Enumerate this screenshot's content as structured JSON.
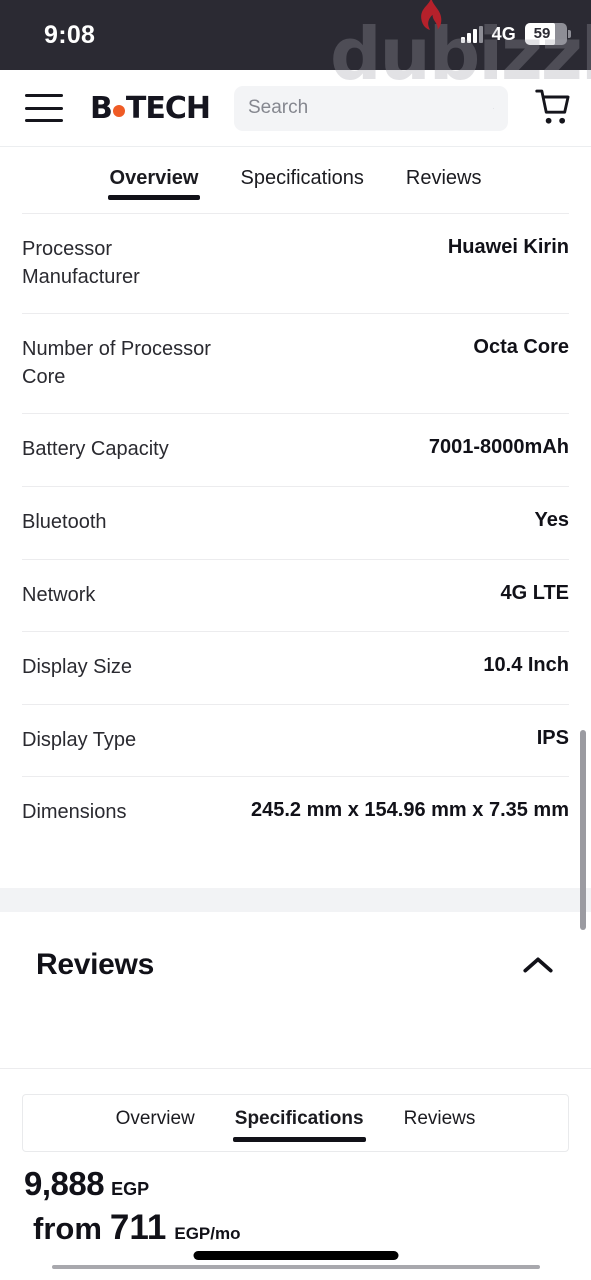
{
  "status_bar": {
    "time": "9:08",
    "network_label": "4G",
    "battery_level": "59",
    "signal_icon": "signal-bars-icon",
    "flame_icon": "flame-icon"
  },
  "watermark": {
    "text": "dubizzle"
  },
  "header": {
    "menu_icon": "hamburger-menu-icon",
    "logo": {
      "prefix": "B",
      "suffix": "TECH",
      "dot_color": "#ef5b25"
    },
    "search": {
      "value": "",
      "placeholder": "Search",
      "icon": "search-icon"
    },
    "cart_icon": "shopping-cart-icon"
  },
  "top_tabs": {
    "items": [
      {
        "label": "Overview",
        "active": true
      },
      {
        "label": "Specifications",
        "active": false
      },
      {
        "label": "Reviews",
        "active": false
      }
    ]
  },
  "specifications": {
    "rows": [
      {
        "label": "Processor Manufacturer",
        "value": "Huawei Kirin"
      },
      {
        "label": "Number of Processor Core",
        "value": "Octa Core"
      },
      {
        "label": "Battery Capacity",
        "value": "7001-8000mAh"
      },
      {
        "label": "Bluetooth",
        "value": "Yes"
      },
      {
        "label": "Network",
        "value": "4G LTE"
      },
      {
        "label": "Display Size",
        "value": "10.4 Inch"
      },
      {
        "label": "Display Type",
        "value": "IPS"
      },
      {
        "label": "Dimensions",
        "value": "245.2 mm x 154.96 mm x 7.35 mm"
      }
    ]
  },
  "reviews_section": {
    "title": "Reviews",
    "toggle_icon": "chevron-up-icon"
  },
  "bottom_tabs": {
    "items": [
      {
        "label": "Overview",
        "active": false
      },
      {
        "label": "Specifications",
        "active": true
      },
      {
        "label": "Reviews",
        "active": false
      }
    ]
  },
  "price": {
    "amount": "9,888",
    "currency": "EGP",
    "installment_prefix": "from",
    "installment_amount": "711",
    "installment_currency": "EGP/mo"
  }
}
